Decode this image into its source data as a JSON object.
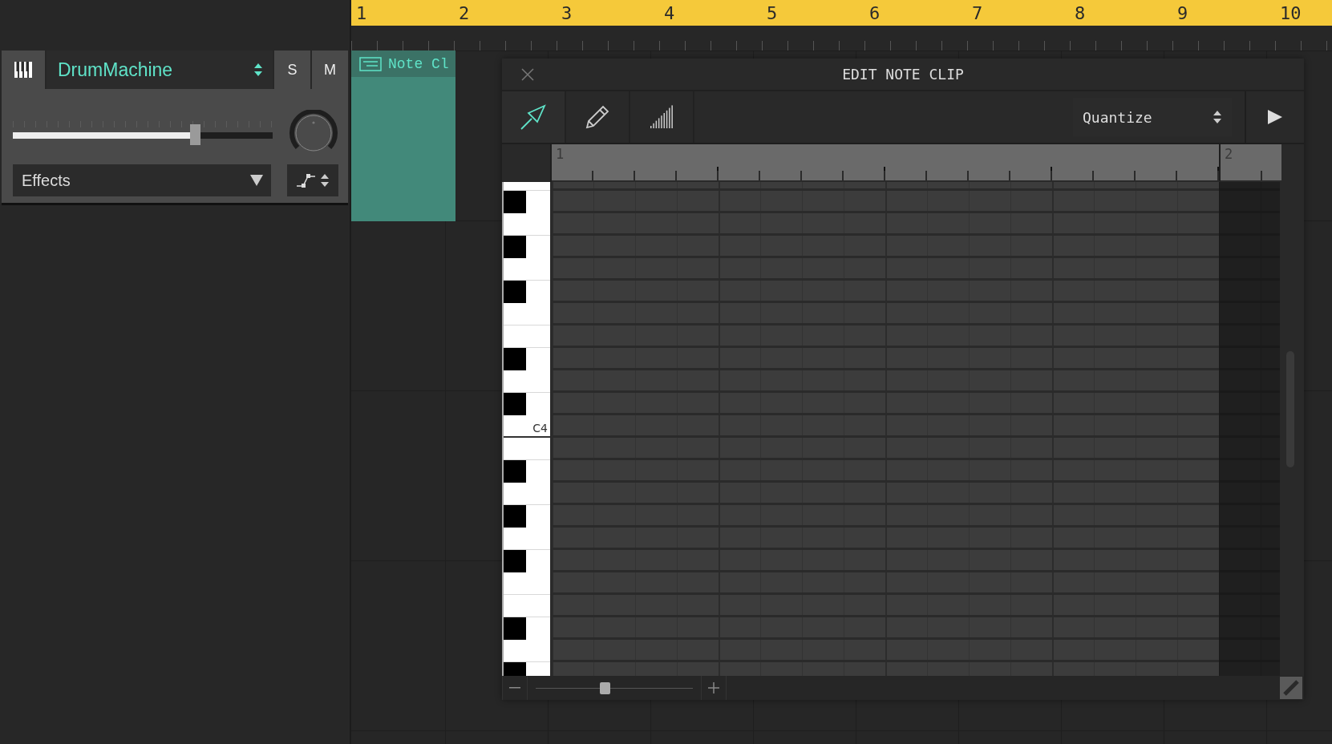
{
  "ruler": {
    "bars": [
      "1",
      "2",
      "3",
      "4",
      "5",
      "6",
      "7",
      "8",
      "9",
      "10"
    ]
  },
  "track": {
    "name": "DrumMachine",
    "solo": {
      "label": "S",
      "on": false
    },
    "mute": {
      "label": "M",
      "on": false
    },
    "volume": {
      "level": 0.7
    },
    "effects": {
      "value": "Effects"
    }
  },
  "clip": {
    "label": "Note Cl"
  },
  "editor": {
    "title": "EDIT NOTE CLIP",
    "tools": [
      {
        "kind": "pointer",
        "selected": true
      },
      {
        "kind": "pencil",
        "selected": false
      },
      {
        "kind": "velocity",
        "selected": false
      }
    ],
    "quantize": {
      "value": "Quantize"
    },
    "ruler": {
      "bars": [
        "1",
        "2"
      ]
    },
    "piano": {
      "label": "C4"
    },
    "zoom": {
      "level": 0.44
    }
  }
}
